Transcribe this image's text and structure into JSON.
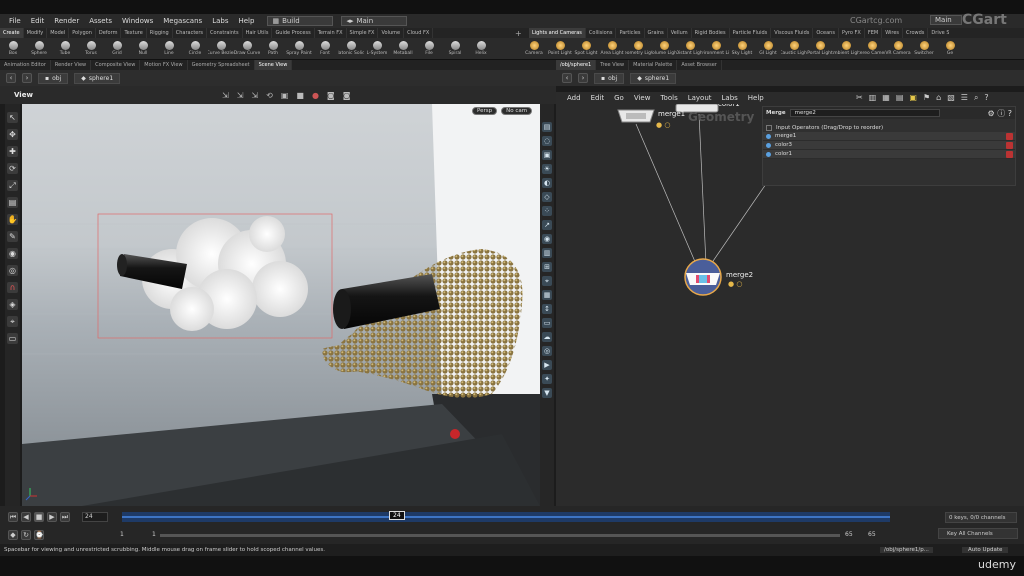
{
  "menubar": {
    "items": [
      "File",
      "Edit",
      "Render",
      "Assets",
      "Windows",
      "Megascans",
      "Labs",
      "Help"
    ],
    "build_label": "Build",
    "main_label": "Main",
    "right_main_label": "Main"
  },
  "watermark": {
    "site": "CGartcg.com",
    "brand": "CGart",
    "corner": "udemy"
  },
  "shelf_tabs_left": [
    "Create",
    "Modify",
    "Model",
    "Polygon",
    "Deform",
    "Texture",
    "Rigging",
    "Characters",
    "Constraints",
    "Hair Utils",
    "Guide Process",
    "Terrain FX",
    "Simple FX",
    "Volume",
    "Cloud FX"
  ],
  "shelf_tools_left": [
    "Box",
    "Sphere",
    "Tube",
    "Torus",
    "Grid",
    "Null",
    "Line",
    "Circle",
    "Curve Bezier",
    "Draw Curve",
    "Path",
    "Spray Paint",
    "Font",
    "Platonic Solids",
    "L-System",
    "Metaball",
    "File",
    "Spiral",
    "Helix"
  ],
  "shelf_tabs_right": [
    "Lights and Cameras",
    "Collisions",
    "Particles",
    "Grains",
    "Vellum",
    "Rigid Bodies",
    "Particle Fluids",
    "Viscous Fluids",
    "Oceans",
    "Pyro FX",
    "FEM",
    "Wires",
    "Crowds",
    "Drive Simulation"
  ],
  "shelf_tools_right": [
    "Camera",
    "Point Light",
    "Spot Light",
    "Area Light",
    "Geometry Light",
    "Volume Light",
    "Distant Light",
    "Environment Light",
    "Sky Light",
    "GI Light",
    "Caustic Light",
    "Portal Light",
    "Ambient Light",
    "Stereo Camera",
    "VR Camera",
    "Switcher",
    "Ge"
  ],
  "pane_tabs_left": [
    "Animation Editor",
    "Render View",
    "Composite View",
    "Motion FX View",
    "Geometry Spreadsheet",
    "Scene View"
  ],
  "pane_tabs_right": [
    "/obj/sphere1",
    "Tree View",
    "Material Palette",
    "Asset Browser"
  ],
  "path_left": {
    "obj": "obj",
    "node": "sphere1"
  },
  "path_right": {
    "obj": "obj",
    "node": "sphere1"
  },
  "viewport": {
    "title": "View",
    "persp": "Persp",
    "cam": "No cam"
  },
  "network_menu": [
    "Add",
    "Edit",
    "Go",
    "View",
    "Tools",
    "Layout",
    "Labs",
    "Help"
  ],
  "network": {
    "watermark": "Geometry",
    "node_merge1": "merge1",
    "node_color": "color1",
    "node_merge2": "merge2"
  },
  "params": {
    "type": "Merge",
    "name": "merge2",
    "header": "Input Operators (Drag/Drop to reorder)",
    "inputs": [
      "merge1",
      "color3",
      "color1"
    ]
  },
  "timeline": {
    "frame": "24",
    "current_marker": "24",
    "start": "1",
    "start2": "1",
    "end": "65",
    "end2": "65",
    "keys_status": "0 keys, 0/0 channels",
    "key_all": "Key All Channels"
  },
  "status": {
    "message": "Spacebar for viewing and unrestricted scrubbing. Middle mouse drag on frame slider to hold scoped channel values.",
    "path": "/obj/sphere1/p...",
    "update": "Auto Update"
  }
}
